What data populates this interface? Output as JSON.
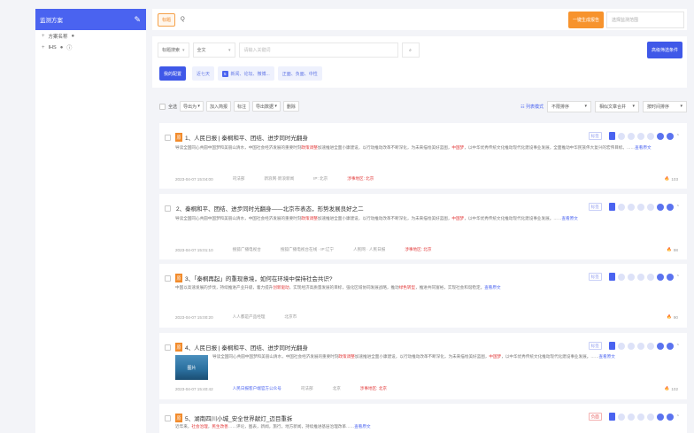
{
  "sidebar": {
    "title": "监测方案",
    "items": [
      {
        "label": "方案名称"
      },
      {
        "label": "IHS"
      }
    ]
  },
  "search": {
    "tag": "标题",
    "query": "Q",
    "button": "一键生成报告",
    "select_placeholder": "选择监测范围"
  },
  "filter": {
    "field_select": "标题搜索",
    "scope_select": "全文",
    "keyword_placeholder": "请输入关键词",
    "advanced_button": "高级筛选条件",
    "quick_label": "我的配置",
    "chips": [
      {
        "label": "近七天"
      },
      {
        "num": "5",
        "label": "新闻、论坛、微博..."
      },
      {
        "label": "正面、负面、中性"
      }
    ]
  },
  "toolbar": {
    "select_all": "全选",
    "buttons": [
      "导出为",
      "加入简报",
      "标注",
      "导出数据",
      "删除"
    ],
    "right_link": "列表模式",
    "selects": [
      "不限排序",
      "相似文章合并",
      "按时间排序"
    ]
  },
  "results": [
    {
      "badge": "原",
      "title": "1、人民日报 | 秦桐和平、团结、进步同时光翻身",
      "body": [
        {
          "t": "导读全国同心共圆中国梦和美丽山清水，中国社会经济发展的重要时刻"
        },
        {
          "t": "政策调整",
          "hl": true
        },
        {
          "t": "加速推进全面小康建设，以行动推动改革不断深化，为未来描绘美好蓝图，"
        },
        {
          "t": "中国梦",
          "hl": true
        },
        {
          "t": "，以中华优秀传统文化推动现代化建设事业发展，全面推动中华民族伟大复兴的宏伟目标。"
        },
        {
          "t": "……"
        },
        {
          "t": "查看原文",
          "more": true
        }
      ],
      "meta": [
        {
          "t": "2023-04-07 15:04:00"
        },
        {
          "t": "司法部"
        },
        {
          "t": "新浪网·新浪新闻"
        },
        {
          "t": "IP: 北京"
        },
        {
          "t": "涉事地区: 北京",
          "red": true
        }
      ],
      "heat": "103",
      "label": "标签",
      "label_red": false
    },
    {
      "title": "2、秦桐和平、团结、进步同时光翻身——北京市表态，形势发展良好之二",
      "body": [
        {
          "t": "导读全国同心共圆中国梦和美丽山清水，中国社会经济发展的重要时刻"
        },
        {
          "t": "政策调整",
          "hl": true
        },
        {
          "t": "加速推进全面小康建设，以行动推动改革不断深化，为未来描绘美好蓝图，"
        },
        {
          "t": "中国梦",
          "hl": true
        },
        {
          "t": "，以中华优秀传统文化推动现代化建设事业发展。"
        },
        {
          "t": "……"
        },
        {
          "t": "查看原文",
          "more": true
        }
      ],
      "meta": [
        {
          "t": "2023-04-07 15:01:10"
        },
        {
          "t": "搜狐广播电视台"
        },
        {
          "t": "搜狐广播电视台在线 · IP:辽宁"
        },
        {
          "t": "人民网 · 人民日报"
        },
        {
          "t": "涉事地区: 北京",
          "red": true
        }
      ],
      "heat": "98",
      "label": "标签",
      "label_red": false
    },
    {
      "badge": "原",
      "title": "3、「秦桐再起」的重现意境，如何在环境中保持社会共识?",
      "body": [
        {
          "t": "中国以高速发展的步伐，持续推进产业升级，着力提升"
        },
        {
          "t": "创新驱动",
          "hl": true
        },
        {
          "t": "，实现经济高质量发展的目标，强化区域协同发展战略，推动"
        },
        {
          "t": "绿色转型",
          "hl": true
        },
        {
          "t": "，推进共同富裕，实现社会和谐稳定。"
        },
        {
          "t": "查看原文",
          "more": true
        }
      ],
      "meta": [
        {
          "t": "2023-04-07 15:00:20"
        },
        {
          "t": "人人都是产品经理"
        },
        {
          "t": "北京市"
        }
      ],
      "heat": "90",
      "label": "标签",
      "label_red": false
    },
    {
      "badge": "原",
      "title": "4、人民日报 | 秦桐和平、团结、进步同时光翻身",
      "thumb": "图片",
      "body": [
        {
          "t": "导读全国同心共圆中国梦和美丽山清水，中国社会经济发展的重要时刻"
        },
        {
          "t": "政策调整",
          "hl": true
        },
        {
          "t": "加速推进全面小康建设，以行动推动改革不断深化，为未来描绘美好蓝图，"
        },
        {
          "t": "中国梦",
          "hl": true
        },
        {
          "t": "，以中华优秀传统文化推动现代化建设事业发展。"
        },
        {
          "t": "……"
        },
        {
          "t": "查看原文",
          "more": true
        }
      ],
      "meta": [
        {
          "t": "2023-04-07 15:40:42"
        },
        {
          "t": "人民日报客户端官方公众号",
          "blue": true
        },
        {
          "t": "司法部"
        },
        {
          "t": "北京"
        },
        {
          "t": "涉事地区: 北京",
          "red": true
        }
      ],
      "heat": "102",
      "label": "标签",
      "label_red": false
    },
    {
      "badge": "原",
      "title": "5、湖南四川小城_安全世界献灯_迈目重拆",
      "body": [
        {
          "t": "近年来，"
        },
        {
          "t": "社会治理",
          "hl": true
        },
        {
          "t": "，"
        },
        {
          "t": "民生改善",
          "hl": true
        },
        {
          "t": "……评论，图表，新闻，旅行，地方新闻，持续推进基层治理改革……"
        },
        {
          "t": "查看原文",
          "more": true
        }
      ],
      "meta": [],
      "heat": "",
      "label": "负面",
      "label_red": true
    }
  ]
}
